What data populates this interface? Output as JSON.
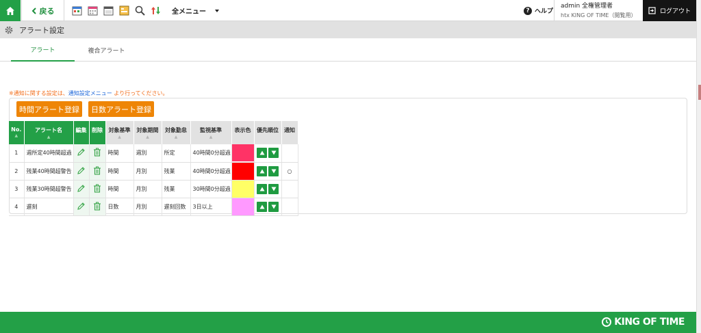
{
  "topbar": {
    "back_label": "戻る",
    "menu_label": "全メニュー",
    "help_label": "ヘルプ",
    "help_glyph": "?",
    "user_name": "admin 全権管理者",
    "user_org": "htx KING OF TIME（閲覧用）",
    "logout_label": "ログアウト"
  },
  "page": {
    "title": "アラート設定"
  },
  "tabs": [
    {
      "label": "アラート",
      "active": true
    },
    {
      "label": "複合アラート",
      "active": false
    }
  ],
  "notice": {
    "prefix": "※通知に関する設定は、",
    "link": "通知設定メニュー",
    "suffix": " より行ってください。"
  },
  "buttons": {
    "time_alert": "時間アラート登録",
    "day_alert": "日数アラート登録"
  },
  "table": {
    "headers": {
      "no": "No.",
      "name": "アラート名",
      "edit": "編集",
      "delete": "削除",
      "basis": "対象基準",
      "period": "対象期間",
      "target": "対象勤怠",
      "monitor": "監視基準",
      "color": "表示色",
      "priority": "優先順位",
      "notify": "通知"
    },
    "rows": [
      {
        "no": "1",
        "name": "週所定40時間超過",
        "basis": "時間",
        "period": "週別",
        "target": "所定",
        "monitor": "40時間0分超過",
        "color": "#ff3366",
        "notify": ""
      },
      {
        "no": "2",
        "name": "残業40時間超警告",
        "basis": "時間",
        "period": "月別",
        "target": "残業",
        "monitor": "40時間0分超過",
        "color": "#ff0000",
        "notify": "○"
      },
      {
        "no": "3",
        "name": "残業30時間超警告",
        "basis": "時間",
        "period": "月別",
        "target": "残業",
        "monitor": "30時間0分超過",
        "color": "#ffff66",
        "notify": ""
      },
      {
        "no": "4",
        "name": "遅刻",
        "basis": "日数",
        "period": "月別",
        "target": "遅刻回数",
        "monitor": "3日以上",
        "color": "#ff99ff",
        "notify": ""
      }
    ]
  },
  "footer": {
    "brand": "KING OF TIME"
  },
  "colors": {
    "brand_green": "#23a047",
    "accent_orange": "#ee8506",
    "notice_orange": "#f26d1b",
    "link_blue": "#1a64d8"
  }
}
